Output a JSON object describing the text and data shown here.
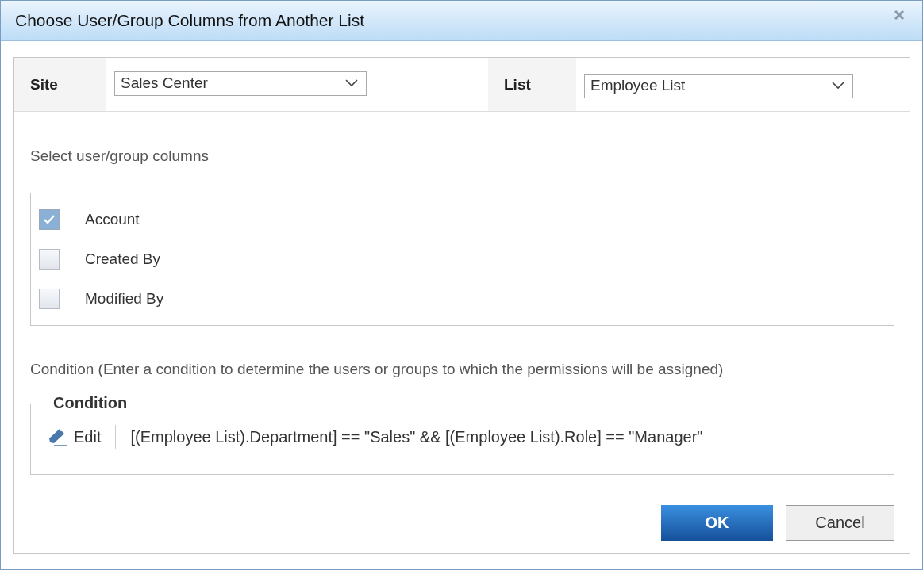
{
  "window": {
    "title": "Choose User/Group Columns from Another List"
  },
  "site": {
    "label": "Site",
    "value": "Sales Center"
  },
  "list": {
    "label": "List",
    "value": "Employee List"
  },
  "columns_heading": "Select user/group columns",
  "columns": [
    {
      "label": "Account",
      "checked": true
    },
    {
      "label": "Created By",
      "checked": false
    },
    {
      "label": "Modified By",
      "checked": false
    }
  ],
  "condition_hint": "Condition (Enter a condition to determine the users or groups to which the permissions will be assigned)",
  "condition": {
    "legend": "Condition",
    "edit_label": "Edit",
    "expression": "[(Employee List).Department] == \"Sales\" && [(Employee List).Role] == \"Manager\""
  },
  "buttons": [
    {
      "label": "OK",
      "kind": "primary"
    },
    {
      "label": "Cancel",
      "kind": "secondary"
    }
  ]
}
